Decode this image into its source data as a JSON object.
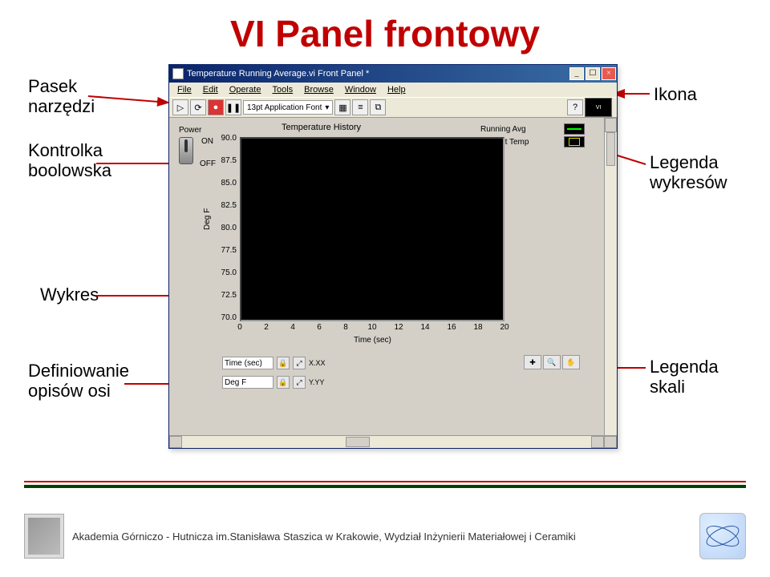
{
  "title": "VI Panel frontowy",
  "labels": {
    "toolbar": "Pasek\nnarzędzi",
    "boolControl": "Kontrolka\nboolowska",
    "chart": "Wykres",
    "axisDef": "Definiowanie\nopisów osi",
    "icon": "Ikona",
    "plotLegend": "Legenda\nwykresów",
    "scaleLegend": "Legenda\nskali"
  },
  "window": {
    "title": "Temperature Running Average.vi Front Panel *",
    "menu": [
      "File",
      "Edit",
      "Operate",
      "Tools",
      "Browse",
      "Window",
      "Help"
    ],
    "font": "13pt Application Font"
  },
  "panel": {
    "power": "Power",
    "on": "ON",
    "off": "OFF",
    "chartTitle": "Temperature History",
    "legend": [
      "Running Avg",
      "Current Temp"
    ],
    "yLabel": "Deg F",
    "xLabel": "Time (sec)",
    "scaleX": {
      "name": "Time (sec)",
      "fmt": "X.XX"
    },
    "scaleY": {
      "name": "Deg F",
      "fmt": "Y.YY"
    },
    "yticks": [
      "90.0",
      "87.5",
      "85.0",
      "82.5",
      "80.0",
      "77.5",
      "75.0",
      "72.5",
      "70.0"
    ],
    "xticks": [
      "0",
      "2",
      "4",
      "6",
      "8",
      "10",
      "12",
      "14",
      "16",
      "18",
      "20"
    ]
  },
  "footer": "Akademia Górniczo - Hutnicza im.Stanisława Staszica w Krakowie, Wydział Inżynierii Materiałowej i Ceramiki",
  "chart_data": {
    "type": "line",
    "title": "Temperature History",
    "xlabel": "Time (sec)",
    "ylabel": "Deg F",
    "xlim": [
      0,
      20
    ],
    "ylim": [
      70,
      90
    ],
    "x": [
      0,
      2,
      4,
      6,
      8,
      10,
      12,
      14,
      16,
      18,
      20
    ],
    "series": [
      {
        "name": "Running Avg",
        "values": []
      },
      {
        "name": "Current Temp",
        "values": []
      }
    ]
  }
}
